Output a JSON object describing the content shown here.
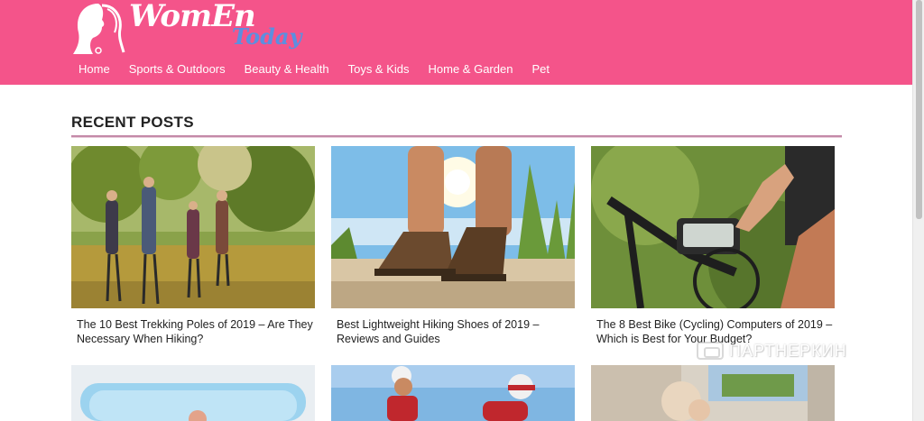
{
  "site": {
    "logo_women": "WomEn",
    "logo_today": "Today",
    "brand_color": "#f4548a"
  },
  "nav": [
    "Home",
    "Sports & Outdoors",
    "Beauty & Health",
    "Toys & Kids",
    "Home & Garden",
    "Pet"
  ],
  "section_title": "RECENT POSTS",
  "posts": [
    {
      "title": "The 10 Best Trekking Poles of 2019 – Are They Necessary When Hiking?",
      "image_icon": "hikers-photo"
    },
    {
      "title": "Best Lightweight Hiking Shoes of 2019 – Reviews and Guides",
      "image_icon": "hiking-shoes-photo"
    },
    {
      "title": "The 8 Best Bike (Cycling) Computers of 2019 – Which is Best for Your Budget?",
      "image_icon": "bike-computer-photo"
    }
  ],
  "watermark": "ПАРТНЕРКИН"
}
